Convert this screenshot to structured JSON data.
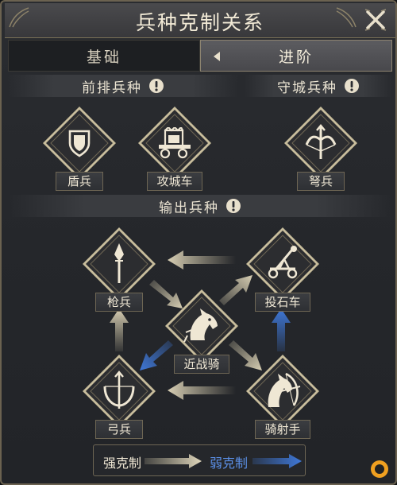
{
  "window": {
    "title": "兵种克制关系"
  },
  "tabs": [
    {
      "label": "基础",
      "active": false
    },
    {
      "label": "进阶",
      "active": true
    }
  ],
  "sections": {
    "front": {
      "title": "前排兵种",
      "icon": "info-icon"
    },
    "siege_defense": {
      "title": "守城兵种",
      "icon": "info-icon"
    },
    "output": {
      "title": "输出兵种",
      "icon": "info-icon"
    }
  },
  "units": {
    "shield": {
      "name": "盾兵",
      "icon": "shield-icon"
    },
    "siege_cart": {
      "name": "攻城车",
      "icon": "siege-cart-icon"
    },
    "crossbow": {
      "name": "弩兵",
      "icon": "crossbow-icon"
    },
    "spear": {
      "name": "枪兵",
      "icon": "spear-icon"
    },
    "catapult": {
      "name": "投石车",
      "icon": "catapult-icon"
    },
    "cavalry": {
      "name": "近战骑",
      "icon": "horse-icon"
    },
    "archer": {
      "name": "弓兵",
      "icon": "bow-icon"
    },
    "horse_archer": {
      "name": "骑射手",
      "icon": "horse-bow-icon"
    }
  },
  "legend": {
    "strong_label": "强克制",
    "weak_label": "弱克制",
    "strong_color": "#d8cfb4",
    "weak_color": "#3f78d8"
  },
  "colors": {
    "frame": "#6b6250",
    "gold": "#b7aa86",
    "arrow_strong": "#c9c0a3",
    "arrow_weak": "#3f78d8"
  }
}
